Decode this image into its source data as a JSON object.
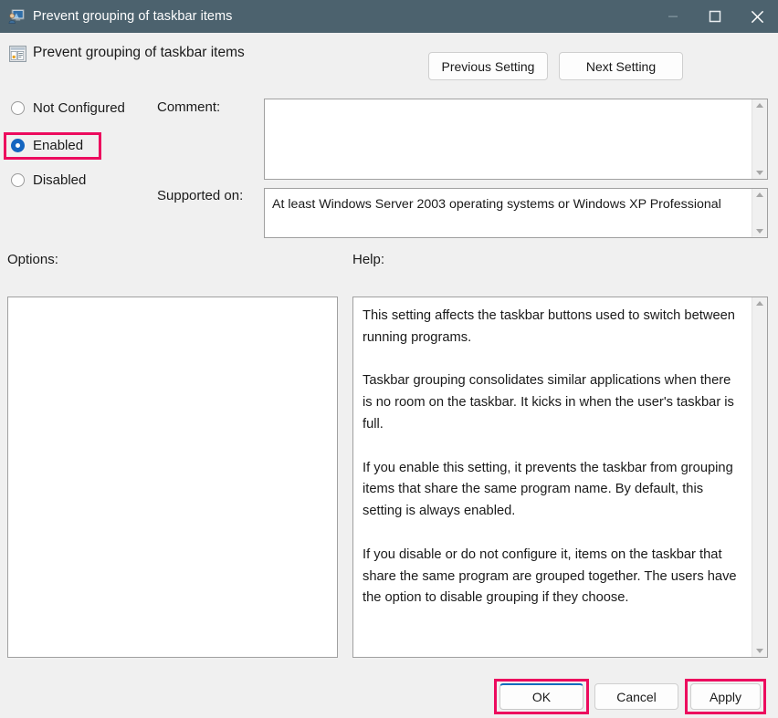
{
  "titlebar": {
    "title": "Prevent grouping of taskbar items",
    "icon": "monitor-user-icon",
    "background": "#4c626e",
    "controls": {
      "minimize": "minimize-icon",
      "maximize": "maximize-icon",
      "close": "close-icon"
    }
  },
  "header": {
    "icon": "policy-setting-icon",
    "title": "Prevent grouping of taskbar items",
    "previous_button": "Previous Setting",
    "next_button": "Next Setting"
  },
  "state": {
    "options": [
      {
        "label": "Not Configured",
        "selected": false,
        "highlighted": false
      },
      {
        "label": "Enabled",
        "selected": true,
        "highlighted": true
      },
      {
        "label": "Disabled",
        "selected": false,
        "highlighted": false
      }
    ],
    "selected_value": "Enabled"
  },
  "comment": {
    "label": "Comment:",
    "value": "",
    "placeholder": ""
  },
  "supported_on": {
    "label": "Supported on:",
    "value": "At least Windows Server 2003 operating systems or Windows XP Professional"
  },
  "options_panel": {
    "label": "Options:",
    "value": ""
  },
  "help_panel": {
    "label": "Help:",
    "value": "This setting affects the taskbar buttons used to switch between running programs.\n\nTaskbar grouping consolidates similar applications when there is no room on the taskbar. It kicks in when the user's taskbar is full.\n\nIf you enable this setting, it prevents the taskbar from grouping items that share the same program name. By default, this setting is always enabled.\n\nIf you disable or do not configure it, items on the taskbar that share the same program are grouped together. The users have the option to disable grouping if they choose."
  },
  "footer": {
    "ok_label": "OK",
    "cancel_label": "Cancel",
    "apply_label": "Apply",
    "default_button": "OK"
  },
  "highlights": {
    "color": "#ec0b5e",
    "targets": [
      "Enabled",
      "OK",
      "Apply"
    ]
  },
  "accent_color": "#0f6cbd"
}
